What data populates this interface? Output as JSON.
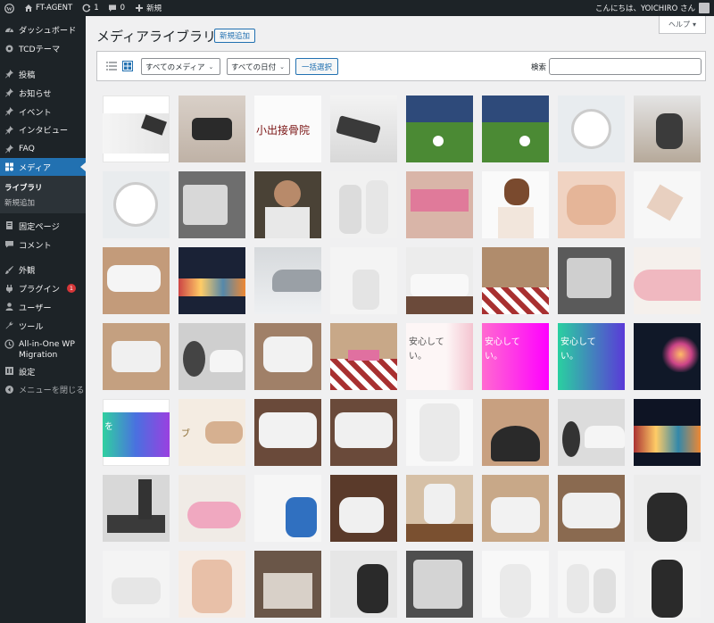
{
  "adminbar": {
    "site_name": "FT-AGENT",
    "updates_count": "1",
    "comments_count": "0",
    "new_label": "新規",
    "greeting": "こんにちは、YOICHIRO さん"
  },
  "sidebar": {
    "items": [
      {
        "label": "ダッシュボード",
        "icon": "dashboard-icon"
      },
      {
        "label": "TCDテーマ",
        "icon": "gear-icon"
      },
      {
        "label": "投稿",
        "icon": "pin-icon"
      },
      {
        "label": "お知らせ",
        "icon": "pin-icon"
      },
      {
        "label": "イベント",
        "icon": "pin-icon"
      },
      {
        "label": "インタビュー",
        "icon": "pin-icon"
      },
      {
        "label": "FAQ",
        "icon": "pin-icon"
      },
      {
        "label": "メディア",
        "icon": "media-icon"
      },
      {
        "label": "固定ページ",
        "icon": "page-icon"
      },
      {
        "label": "コメント",
        "icon": "comment-icon"
      },
      {
        "label": "外観",
        "icon": "brush-icon"
      },
      {
        "label": "プラグイン",
        "icon": "plugin-icon",
        "badge": "1"
      },
      {
        "label": "ユーザー",
        "icon": "user-icon"
      },
      {
        "label": "ツール",
        "icon": "wrench-icon"
      },
      {
        "label": "All-in-One WP Migration",
        "icon": "migration-icon"
      },
      {
        "label": "設定",
        "icon": "settings-icon"
      },
      {
        "label": "メニューを閉じる",
        "icon": "collapse-icon"
      }
    ],
    "submenu": {
      "library": "ライブラリ",
      "add_new": "新規追加"
    }
  },
  "header": {
    "title": "メディアライブラリ",
    "add_new": "新規追加",
    "help": "ヘルプ"
  },
  "toolbar": {
    "media_filter": "すべてのメディア",
    "date_filter": "すべての日付",
    "bulk_select": "一括選択",
    "search_label": "検索"
  },
  "thumb_texts": {
    "clinic_sign": "小出接骨院",
    "banner_line1": "安心して",
    "banner_line2": "い。",
    "banner_left": "を",
    "banner_frag": "ブ"
  },
  "colors": {
    "accent": "#2271b1",
    "admin_bg": "#1d2327",
    "badge": "#d63638"
  }
}
